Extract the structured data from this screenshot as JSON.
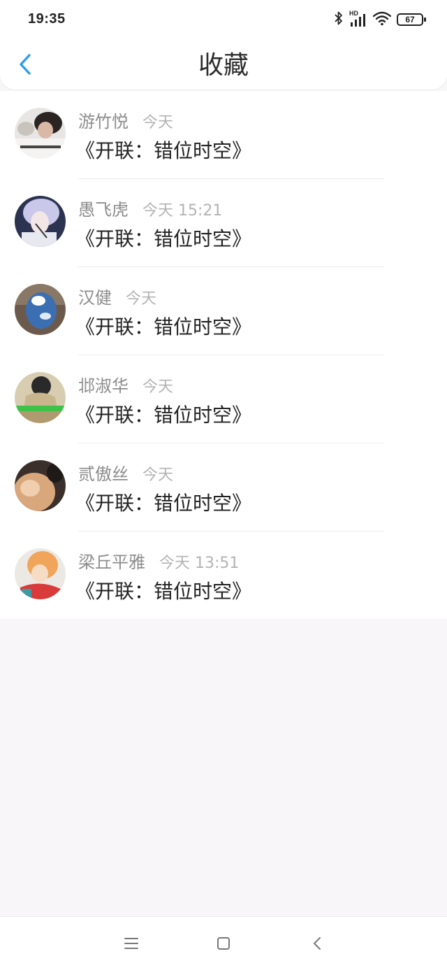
{
  "status_bar": {
    "time": "19:35",
    "network_label": "HD",
    "battery": "67",
    "icons": [
      "bluetooth-icon",
      "signal-icon",
      "wifi-icon",
      "battery-icon"
    ]
  },
  "header": {
    "title": "收藏",
    "back_icon": "chevron-left-icon",
    "accent_color": "#2d9ee8"
  },
  "favorites": [
    {
      "name": "游竹悦",
      "time": "今天",
      "title": "《开联：错位时空》"
    },
    {
      "name": "愚飞虎",
      "time": "今天 15:21",
      "title": "《开联：错位时空》"
    },
    {
      "name": "汉健",
      "time": "今天",
      "title": "《开联：错位时空》"
    },
    {
      "name": "邶淑华",
      "time": "今天",
      "title": "《开联：错位时空》"
    },
    {
      "name": "贰傲丝",
      "time": "今天",
      "title": "《开联：错位时空》"
    },
    {
      "name": "梁丘平雅",
      "time": "今天 13:51",
      "title": "《开联：错位时空》"
    }
  ],
  "nav_bar": {
    "icons": [
      "menu-icon",
      "home-icon",
      "back-icon"
    ]
  }
}
